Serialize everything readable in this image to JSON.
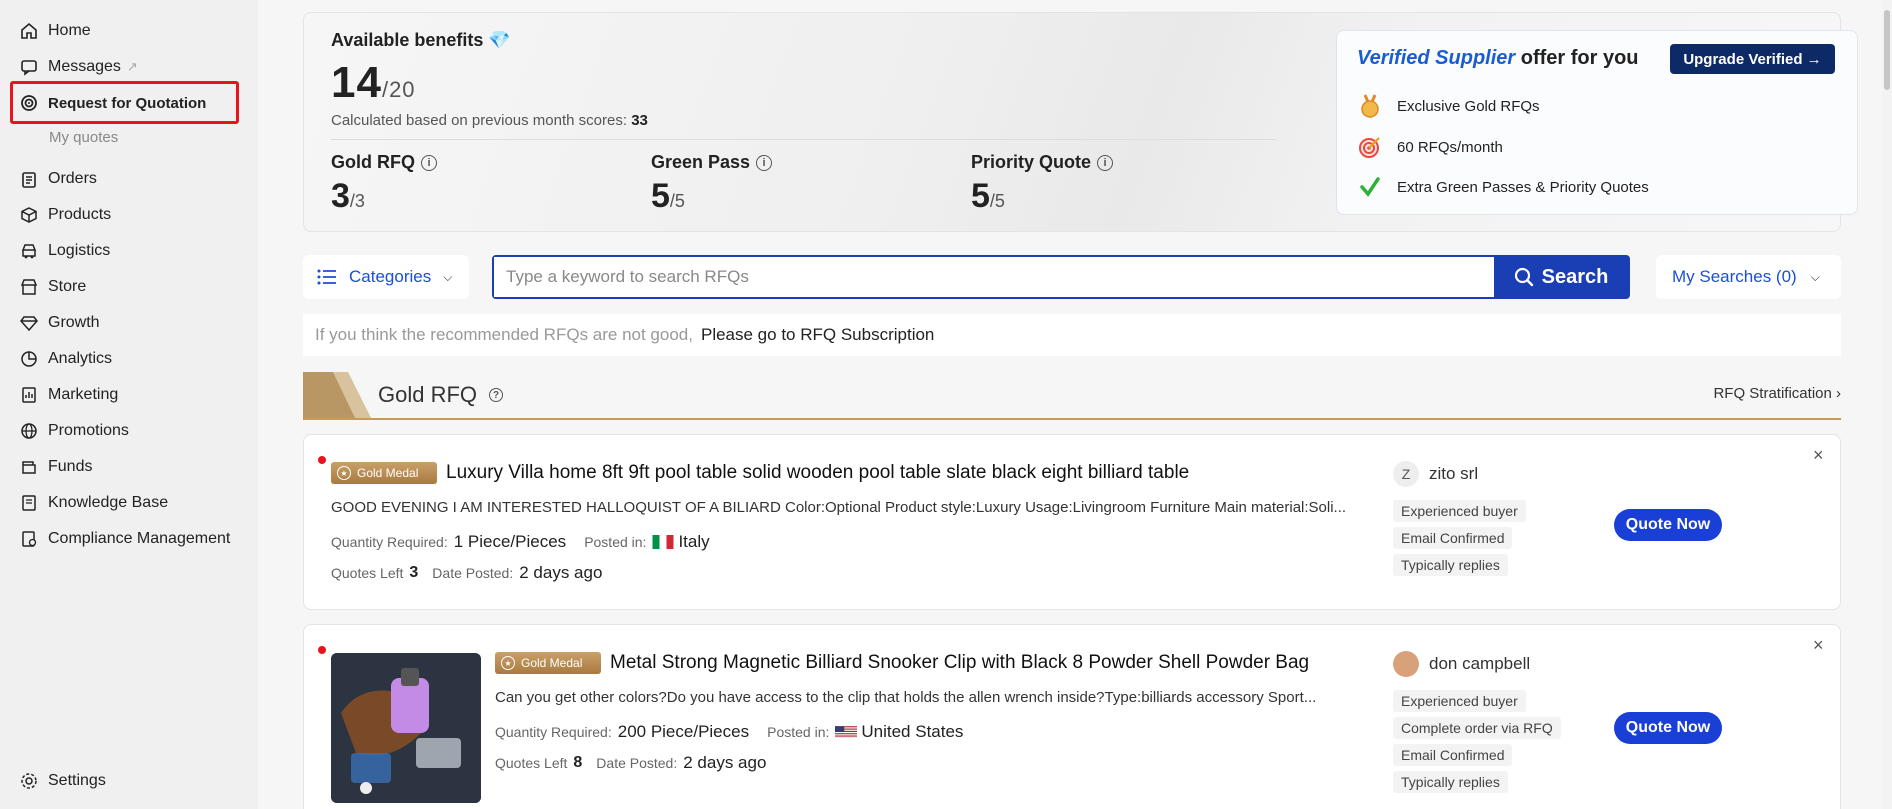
{
  "sidebar": {
    "items": [
      {
        "label": "Home",
        "icon": "home-icon"
      },
      {
        "label": "Messages",
        "icon": "chat-icon",
        "external": "↗"
      },
      {
        "label": "Request for Quotation",
        "icon": "rfq-icon"
      },
      {
        "label": "Orders",
        "icon": "clipboard-icon"
      },
      {
        "label": "Products",
        "icon": "box-icon"
      },
      {
        "label": "Logistics",
        "icon": "truck-icon"
      },
      {
        "label": "Store",
        "icon": "store-icon"
      },
      {
        "label": "Growth",
        "icon": "diamond-icon"
      },
      {
        "label": "Analytics",
        "icon": "pie-chart-icon"
      },
      {
        "label": "Marketing",
        "icon": "chart-board-icon"
      },
      {
        "label": "Promotions",
        "icon": "globe-icon"
      },
      {
        "label": "Funds",
        "icon": "wallet-icon"
      },
      {
        "label": "Knowledge Base",
        "icon": "book-icon"
      },
      {
        "label": "Compliance Management",
        "icon": "compliance-icon"
      }
    ],
    "sub_my_quotes": "My quotes",
    "settings": "Settings"
  },
  "benefits": {
    "title": "Available benefits",
    "available": "14",
    "total": "/20",
    "calc_label": "Calculated based on previous month scores:",
    "calc_value": "33",
    "metrics": [
      {
        "label": "Gold RFQ",
        "value": "3",
        "total": "/3"
      },
      {
        "label": "Green Pass",
        "value": "5",
        "total": "/5"
      },
      {
        "label": "Priority Quote",
        "value": "5",
        "total": "/5"
      }
    ]
  },
  "verified": {
    "title_brand": "Verified Supplier",
    "title_rest": " offer for you",
    "upgrade_label": "Upgrade Verified →",
    "items": [
      {
        "label": "Exclusive Gold RFQs",
        "icon": "gold-medal-icon"
      },
      {
        "label": "60 RFQs/month",
        "icon": "target-icon"
      },
      {
        "label": "Extra Green Passes & Priority Quotes",
        "icon": "check-icon"
      }
    ]
  },
  "search": {
    "categories_label": "Categories",
    "placeholder": "Type a keyword to search RFQs",
    "button_label": "Search",
    "my_searches": "My Searches (0)"
  },
  "notice": {
    "text": "If you think the recommended RFQs are not good,",
    "link": "Please go to RFQ Subscription"
  },
  "gold_section": {
    "title": "Gold RFQ",
    "stratification": "RFQ Stratification ›"
  },
  "rfqs": [
    {
      "badge": "Gold Medal",
      "title": "Luxury Villa home 8ft 9ft pool table solid wooden pool table slate black eight billiard table",
      "desc": "GOOD EVENING I AM INTERESTED HALLOQUIST OF A BILIARD Color:Optional Product style:Luxury Usage:Livingroom Furniture Main material:Soli...",
      "qty_label": "Quantity Required:",
      "qty": "1 Piece/Pieces",
      "posted_label": "Posted in:",
      "country": "Italy",
      "quotes_left_label": "Quotes Left",
      "quotes_left": "3",
      "date_label": "Date Posted:",
      "date": "2 days ago",
      "buyer_initial": "Z",
      "buyer": "zito srl",
      "tags": [
        "Experienced buyer",
        "Email Confirmed",
        "Typically replies"
      ],
      "quote_label": "Quote Now"
    },
    {
      "badge": "Gold Medal",
      "title": "Metal Strong Magnetic Billiard Snooker Clip with Black 8 Powder Shell Powder Bag",
      "desc": "Can you get other colors?Do you have access to the clip that holds the allen wrench inside?Type:billiards accessory Sport...",
      "qty_label": "Quantity Required:",
      "qty": "200 Piece/Pieces",
      "posted_label": "Posted in:",
      "country": "United States",
      "quotes_left_label": "Quotes Left",
      "quotes_left": "8",
      "date_label": "Date Posted:",
      "date": "2 days ago",
      "buyer": "don campbell",
      "tags": [
        "Experienced buyer",
        "Complete order via RFQ",
        "Email Confirmed",
        "Typically replies"
      ],
      "quote_label": "Quote Now"
    }
  ],
  "colors": {
    "accent": "#1a3fb5",
    "highlight": "#e8141c",
    "gold": "#c49a5e"
  }
}
